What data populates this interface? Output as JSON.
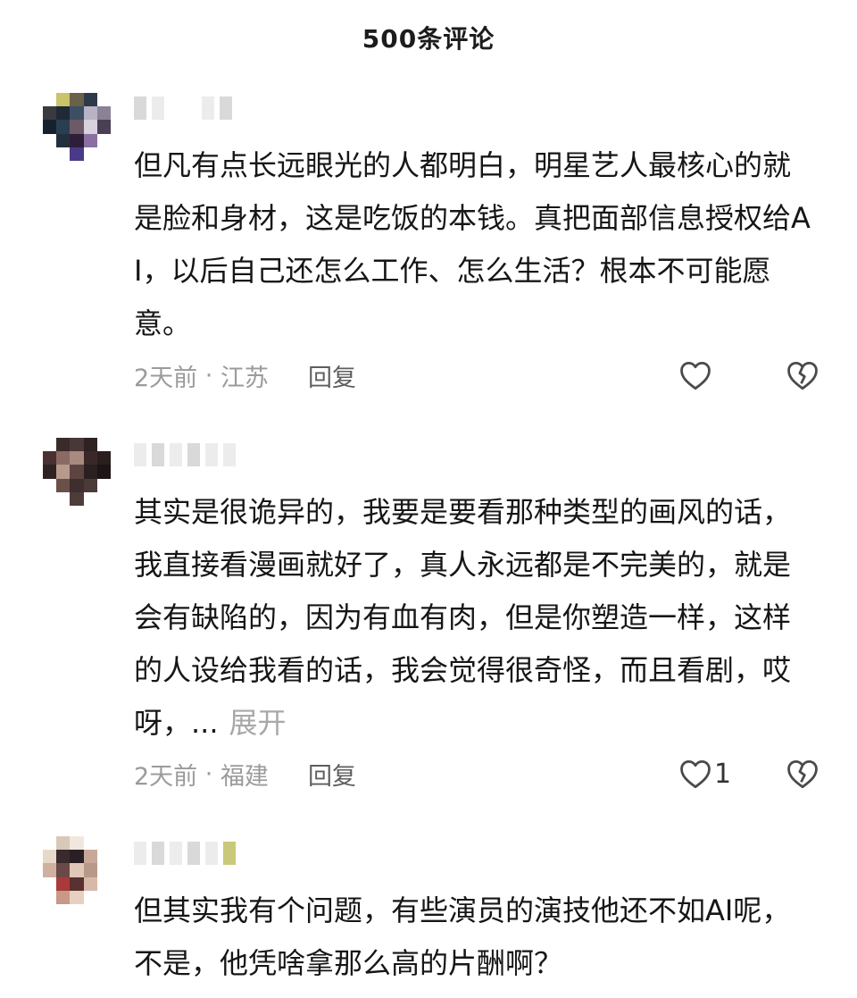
{
  "header": {
    "title": "500条评论"
  },
  "comments": [
    {
      "text": "但凡有点长远眼光的人都明白，明星艺人最核心的就是脸和身材，这是吃饭的本钱。真把面部信息授权给AI，以后自己还怎么工作、怎么生活？根本不可能愿意。",
      "time": "2天前",
      "sep": " · ",
      "location": "江苏",
      "reply_label": "回复",
      "like_count": "",
      "like_icon": "heart-outline-icon",
      "dislike_icon": "broken-heart-icon"
    },
    {
      "text": "其实是很诡异的，我要是要看那种类型的画风的话，我直接看漫画就好了，真人永远都是不完美的，就是会有缺陷的，因为有血有肉，但是你塑造一样，这样的人设给我看的话，我会觉得很奇怪，而且看剧，哎呀，...",
      "expand_label": "展开",
      "time": "2天前",
      "sep": " · ",
      "location": "福建",
      "reply_label": "回复",
      "like_count": "1",
      "like_icon": "heart-outline-icon",
      "dislike_icon": "broken-heart-icon"
    },
    {
      "text": "但其实我有个问题，有些演员的演技他还不如AI呢，不是，他凭啥拿那么高的片酬啊？"
    }
  ]
}
